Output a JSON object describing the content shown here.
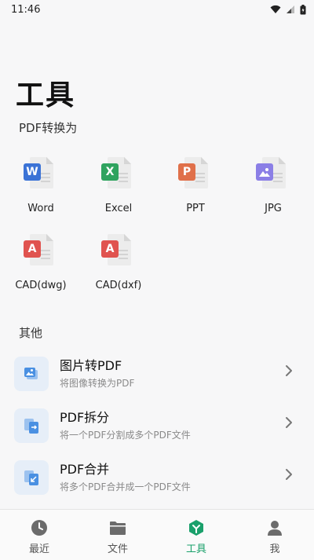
{
  "status_bar": {
    "time": "11:46"
  },
  "page_title": "工具",
  "sections": {
    "convert_title": "PDF转换为",
    "other_title": "其他"
  },
  "convert_tools": [
    {
      "label": "Word",
      "badge": "W",
      "color": "#3b73d6"
    },
    {
      "label": "Excel",
      "badge": "X",
      "color": "#2fa35f"
    },
    {
      "label": "PPT",
      "badge": "P",
      "color": "#e0704a"
    },
    {
      "label": "JPG",
      "badge": "",
      "color": "#8b7fe6"
    },
    {
      "label": "CAD(dwg)",
      "badge": "A",
      "color": "#e0534f"
    },
    {
      "label": "CAD(dxf)",
      "badge": "A",
      "color": "#e0534f"
    }
  ],
  "other_tools": [
    {
      "title": "图片转PDF",
      "subtitle": "将图像转换为PDF"
    },
    {
      "title": "PDF拆分",
      "subtitle": "将一个PDF分割成多个PDF文件"
    },
    {
      "title": "PDF合并",
      "subtitle": "将多个PDF合并成一个PDF文件"
    }
  ],
  "tabs": [
    {
      "label": "最近",
      "icon": "clock-icon"
    },
    {
      "label": "文件",
      "icon": "folder-icon"
    },
    {
      "label": "工具",
      "icon": "tools-icon",
      "active": true
    },
    {
      "label": "我",
      "icon": "person-icon"
    }
  ],
  "colors": {
    "accent": "#1aa06b",
    "list_icon_bg": "#e6eef8",
    "list_icon_fg": "#4a90e2"
  }
}
